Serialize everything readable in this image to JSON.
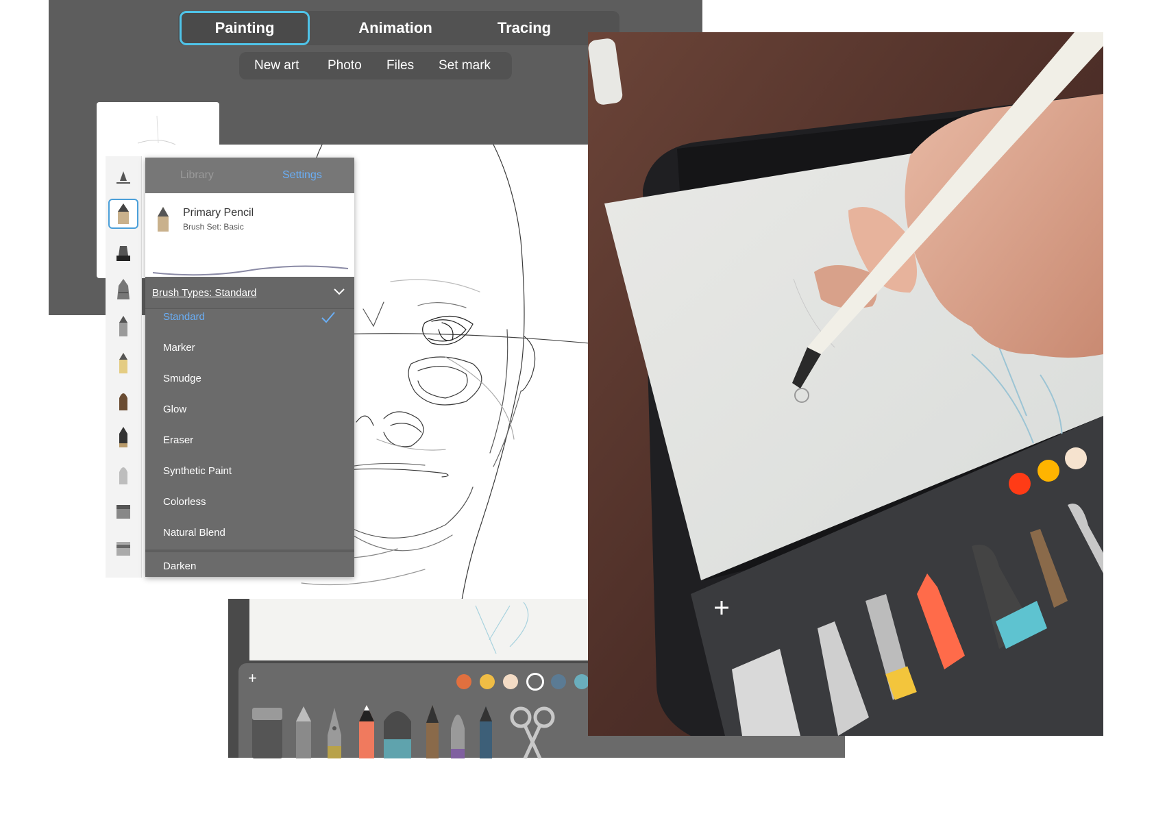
{
  "modes": {
    "tabs": [
      {
        "label": "Painting",
        "active": true
      },
      {
        "label": "Animation",
        "active": false
      },
      {
        "label": "Tracing",
        "active": false
      }
    ]
  },
  "sub_menu": {
    "items": [
      "New art",
      "Photo",
      "Files",
      "Set mark"
    ]
  },
  "brush_panel": {
    "tabs": [
      "Library",
      "Settings"
    ],
    "active_tab": "Settings",
    "brush_name": "Primary Pencil",
    "brush_set": "Brush Set: Basic",
    "brush_types_label": "Brush Types: Standard",
    "types": [
      "Standard",
      "Marker",
      "Smudge",
      "Glow",
      "Eraser",
      "Synthetic Paint",
      "Colorless",
      "Natural Blend",
      "Darken"
    ],
    "selected_type": "Standard"
  },
  "bottom_toolbar": {
    "add_label": "+",
    "colors": [
      "#e1703f",
      "#f0bd45",
      "#f4dcc5",
      "#4a4a4a",
      "#5b7b94",
      "#6aaebd"
    ]
  },
  "photo": {
    "add_label": "+",
    "colors": [
      "#ff3b16",
      "#ffb400",
      "#f6e3cf"
    ]
  },
  "colors": {
    "accent": "#4fc3e8",
    "panel_dark": "#5d5d5d",
    "selection_blue": "#6aaef5"
  }
}
